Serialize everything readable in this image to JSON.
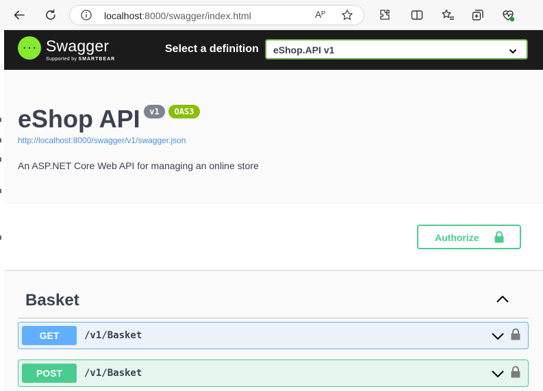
{
  "browser": {
    "url_host": "localhost",
    "url_rest": ":8000/swagger/index.html",
    "read_aloud": "Aᴾ"
  },
  "topbar": {
    "logo_text": "Swagger",
    "logo_sub_prefix": "Supported by",
    "logo_sub_brand": "SMARTBEAR",
    "select_label": "Select a definition",
    "selected_definition": "eShop.API v1",
    "accent": "#85ea2d"
  },
  "info": {
    "title": "eShop API",
    "version_badge": "v1",
    "oas_badge": "OAS3",
    "spec_url": "http://localhost:8000/swagger/v1/swagger.json",
    "description": "An ASP.NET Core Web API for managing an online store"
  },
  "auth": {
    "authorize_label": "Authorize",
    "color": "#49cc90"
  },
  "tag": {
    "name": "Basket"
  },
  "operations": [
    {
      "method": "GET",
      "path": "/v1/Basket",
      "color": "#61affe"
    },
    {
      "method": "POST",
      "path": "/v1/Basket",
      "color": "#49cc90"
    }
  ]
}
